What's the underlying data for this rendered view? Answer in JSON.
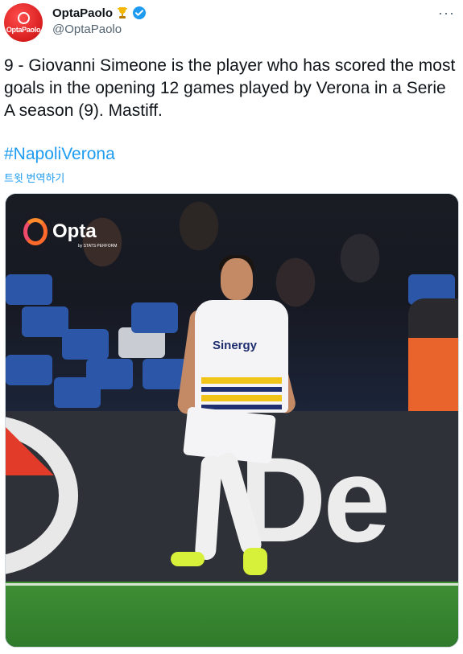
{
  "header": {
    "avatar_text": "OptaPaolo",
    "display_name": "OptaPaolo",
    "handle": "@OptaPaolo",
    "more_label": "···"
  },
  "tweet": {
    "text": "9 - Giovanni Simeone is the player who has scored the most goals in the opening 12 games played by Verona in a Serie A season (9). Mastiff.",
    "hashtag": "#NapoliVerona",
    "translate_label": "트윗 번역하기"
  },
  "photo": {
    "overlay_logo": "Opta",
    "overlay_sub": "by STATS PERFORM",
    "shirt_sponsor": "Sinergy",
    "ad_board_text": "De"
  },
  "colors": {
    "link": "#1d9bf0",
    "avatar_red": "#d81e1e",
    "verified": "#1d9bf0",
    "opta_orange": "#ff6a2b"
  },
  "icons": {
    "trophy": "trophy-icon",
    "verified": "verified-badge-icon",
    "more": "more-icon"
  }
}
